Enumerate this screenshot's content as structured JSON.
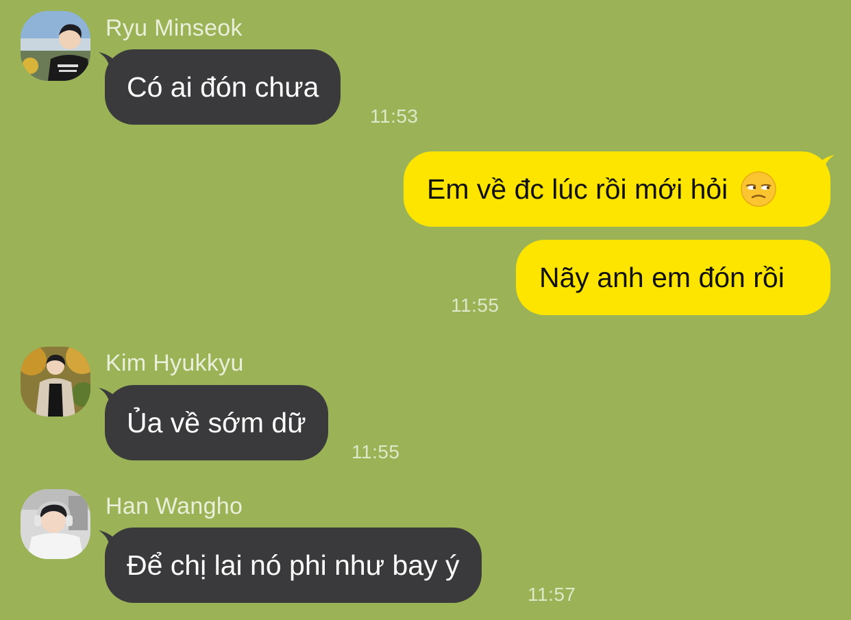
{
  "messages": [
    {
      "sender": "Ryu Minseok",
      "text": "Có ai đón chưa",
      "time": "11:53",
      "direction": "incoming"
    },
    {
      "sender": "",
      "text": "Em về đc lúc rồi mới hỏi",
      "time": "",
      "direction": "outgoing",
      "emoji": "unamused-face-icon"
    },
    {
      "sender": "",
      "text": "Nãy anh em đón rồi",
      "time": "11:55",
      "direction": "outgoing"
    },
    {
      "sender": "Kim Hyukkyu",
      "text": "Ủa về sớm dữ",
      "time": "11:55",
      "direction": "incoming"
    },
    {
      "sender": "Han Wangho",
      "text": "Để chị lai nó phi như bay ý",
      "time": "11:57",
      "direction": "incoming"
    }
  ],
  "colors": {
    "background": "#9bb356",
    "incoming_bubble": "#3a3a3c",
    "outgoing_bubble": "#fde500"
  }
}
